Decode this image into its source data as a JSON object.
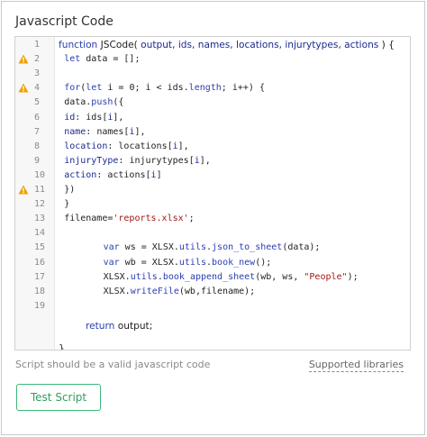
{
  "section": {
    "title": "Javascript Code"
  },
  "editor": {
    "warning_color": "#f0a000",
    "lines": [
      {
        "n": "1",
        "warn": false,
        "style": "sans",
        "indent": 0,
        "parts": [
          [
            "kw",
            "function "
          ],
          [
            "",
            "JSCode( "
          ],
          [
            "idt",
            "output, ids, names, locations, injurytypes, actions"
          ],
          [
            "",
            " ) {"
          ]
        ]
      },
      {
        "n": "2",
        "warn": true,
        "style": "mono",
        "indent": 1,
        "parts": [
          [
            "kw",
            "let"
          ],
          [
            "",
            " data = [];"
          ]
        ]
      },
      {
        "n": "3",
        "warn": false,
        "style": "mono",
        "indent": 0,
        "parts": []
      },
      {
        "n": "4",
        "warn": true,
        "style": "mono",
        "indent": 1,
        "parts": [
          [
            "kw",
            "for"
          ],
          [
            "",
            "("
          ],
          [
            "kw",
            "let"
          ],
          [
            "",
            " i = 0; i < ids."
          ],
          [
            "fn",
            "length"
          ],
          [
            "",
            "; i++) {"
          ]
        ]
      },
      {
        "n": "5",
        "warn": false,
        "style": "mono",
        "indent": 1,
        "parts": [
          [
            "",
            "data."
          ],
          [
            "fn",
            "push"
          ],
          [
            "",
            "({"
          ]
        ]
      },
      {
        "n": "6",
        "warn": false,
        "style": "mono",
        "indent": 1,
        "parts": [
          [
            "idt",
            "id"
          ],
          [
            "",
            ": ids["
          ],
          [
            "idt",
            "i"
          ],
          [
            "",
            "],"
          ]
        ]
      },
      {
        "n": "7",
        "warn": false,
        "style": "mono",
        "indent": 1,
        "parts": [
          [
            "idt",
            "name"
          ],
          [
            "",
            ": names["
          ],
          [
            "idt",
            "i"
          ],
          [
            "",
            "],"
          ]
        ]
      },
      {
        "n": "8",
        "warn": false,
        "style": "mono",
        "indent": 1,
        "parts": [
          [
            "idt",
            "location"
          ],
          [
            "",
            ": locations["
          ],
          [
            "idt",
            "i"
          ],
          [
            "",
            "],"
          ]
        ]
      },
      {
        "n": "9",
        "warn": false,
        "style": "mono",
        "indent": 1,
        "parts": [
          [
            "idt",
            "injuryType"
          ],
          [
            "",
            ": injurytypes["
          ],
          [
            "idt",
            "i"
          ],
          [
            "",
            "],"
          ]
        ]
      },
      {
        "n": "10",
        "warn": false,
        "style": "mono",
        "indent": 1,
        "parts": [
          [
            "idt",
            "action"
          ],
          [
            "",
            ": actions["
          ],
          [
            "idt",
            "i"
          ],
          [
            "",
            "]"
          ]
        ]
      },
      {
        "n": "11",
        "warn": true,
        "style": "mono",
        "indent": 1,
        "parts": [
          [
            "",
            "})"
          ]
        ]
      },
      {
        "n": "12",
        "warn": false,
        "style": "mono",
        "indent": 1,
        "parts": [
          [
            "",
            "}"
          ]
        ]
      },
      {
        "n": "13",
        "warn": false,
        "style": "mono",
        "indent": 1,
        "parts": [
          [
            "",
            "filename="
          ],
          [
            "str",
            "'reports.xlsx'"
          ],
          [
            "",
            ";"
          ]
        ]
      },
      {
        "n": "14",
        "warn": false,
        "style": "mono",
        "indent": 0,
        "parts": []
      },
      {
        "n": "15",
        "warn": false,
        "style": "mono",
        "indent": 8,
        "parts": [
          [
            "kw",
            "var"
          ],
          [
            "",
            " ws = XLSX."
          ],
          [
            "fn",
            "utils"
          ],
          [
            "",
            "."
          ],
          [
            "fn",
            "json_to_sheet"
          ],
          [
            "",
            "(data);"
          ]
        ]
      },
      {
        "n": "16",
        "warn": false,
        "style": "mono",
        "indent": 8,
        "parts": [
          [
            "kw",
            "var"
          ],
          [
            "",
            " wb = XLSX."
          ],
          [
            "fn",
            "utils"
          ],
          [
            "",
            "."
          ],
          [
            "fn",
            "book_new"
          ],
          [
            "",
            "();"
          ]
        ]
      },
      {
        "n": "17",
        "warn": false,
        "style": "mono",
        "indent": 8,
        "parts": [
          [
            "",
            "XLSX."
          ],
          [
            "fn",
            "utils"
          ],
          [
            "",
            "."
          ],
          [
            "fn",
            "book_append_sheet"
          ],
          [
            "",
            "(wb, ws, "
          ],
          [
            "str",
            "\"People\""
          ],
          [
            "",
            ");"
          ]
        ]
      },
      {
        "n": "18",
        "warn": false,
        "style": "mono",
        "indent": 8,
        "parts": [
          [
            "",
            "XLSX."
          ],
          [
            "fn",
            "writeFile"
          ],
          [
            "",
            "(wb,filename);"
          ]
        ]
      },
      {
        "n": "19",
        "warn": false,
        "style": "mono",
        "indent": 0,
        "parts": []
      }
    ],
    "tail_lines": [
      {
        "style": "sans",
        "indent": 5,
        "parts": [
          [
            "kw",
            "return "
          ],
          [
            "",
            "output;"
          ]
        ]
      },
      {
        "style": "sans",
        "indent": 0,
        "parts": [
          [
            "",
            "}"
          ]
        ]
      }
    ]
  },
  "footer": {
    "hint": "Script should be a valid javascript code",
    "supported_libraries": "Supported libraries",
    "test_button": "Test Script",
    "accent_color": "#3cb878"
  }
}
